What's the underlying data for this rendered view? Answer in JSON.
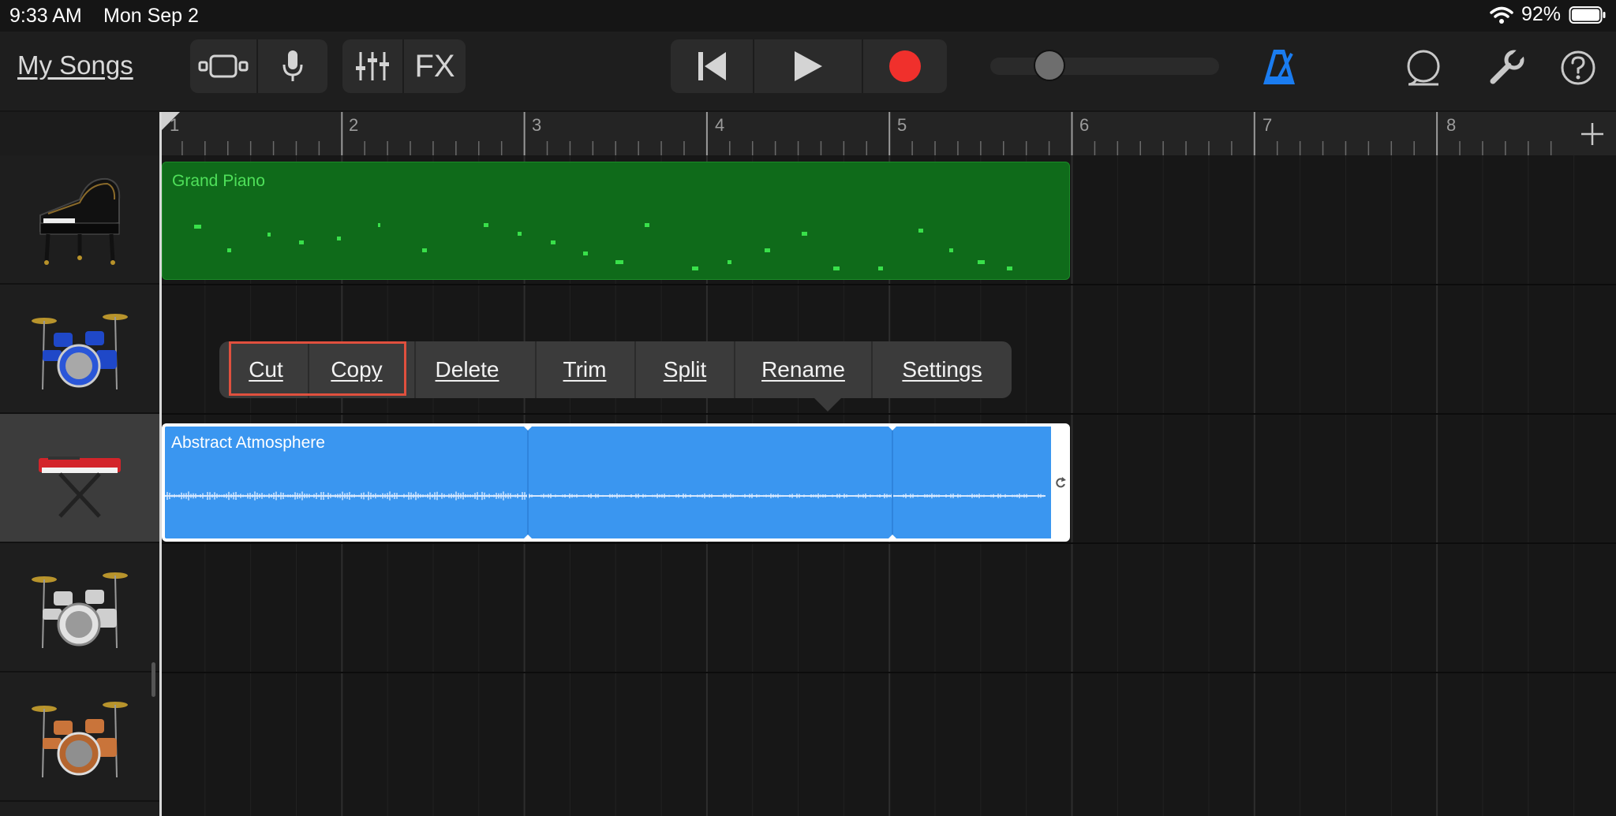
{
  "status": {
    "time": "9:33 AM",
    "date": "Mon Sep 2",
    "battery": "92%",
    "icons": [
      "wifi-icon",
      "battery-icon"
    ]
  },
  "toolbar": {
    "my_songs": "My Songs",
    "fx": "FX",
    "icons": [
      "tracks-view-icon",
      "microphone-icon",
      "mixer-icon",
      "rewind-icon",
      "play-icon",
      "record-icon",
      "metronome-icon",
      "loop-browser-icon",
      "settings-wrench-icon",
      "help-icon"
    ],
    "accent": "#1a7cf0",
    "record_color": "#f0302c"
  },
  "ruler": {
    "bars": [
      "1",
      "2",
      "3",
      "4",
      "5",
      "6",
      "7",
      "8"
    ],
    "add_icon": "plus-icon"
  },
  "tracks": [
    {
      "instrument": "grand-piano-icon"
    },
    {
      "instrument": "drum-kit-blue-icon"
    },
    {
      "instrument": "keyboard-synth-icon",
      "selected": true
    },
    {
      "instrument": "drum-kit-silver-icon"
    },
    {
      "instrument": "drum-kit-wood-icon"
    }
  ],
  "regions": {
    "piano": {
      "label": "Grand Piano",
      "color": "#0f6b1a"
    },
    "atmosphere": {
      "label": "Abstract Atmosphere",
      "color": "#3a96f0"
    }
  },
  "menu": {
    "items": [
      "Cut",
      "Copy",
      "Delete",
      "Trim",
      "Split",
      "Rename",
      "Settings"
    ]
  }
}
